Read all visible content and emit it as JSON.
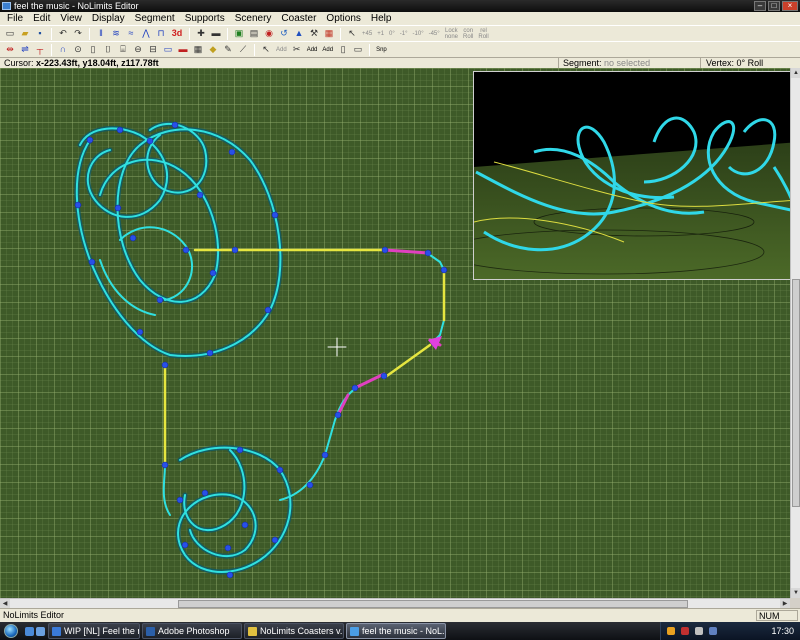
{
  "window": {
    "title": "feel the music - NoLimits Editor",
    "controls": [
      "minimize",
      "maximize",
      "close"
    ]
  },
  "menu": [
    "File",
    "Edit",
    "View",
    "Display",
    "Segment",
    "Supports",
    "Scenery",
    "Coaster",
    "Options",
    "Help"
  ],
  "toolbar1": {
    "labels": {
      "3d": "3d",
      "plus45": "+45",
      "plus1": "+1",
      "zero": "0°",
      "minus1": "-1°",
      "minus10": "-10°",
      "minus45": "-45°",
      "lock": "Lock\nnone",
      "con": "con\nRoll",
      "rel": "rel\nRoll"
    }
  },
  "toolbar2": {
    "labels": {
      "add1": "Add",
      "add2": "Add",
      "add3": "Add",
      "snp": "Snp"
    }
  },
  "status_row": {
    "cursor_label": "Cursor:",
    "cursor_value": "x-223.43ft, y18.04ft, z117.78ft",
    "segment_label": "Segment:",
    "segment_value": "no selected",
    "vertex_label": "Vertex:",
    "vertex_value": "0° Roll"
  },
  "app_status": {
    "text": "NoLimits Editor",
    "num_indicator": "NUM"
  },
  "taskbar": {
    "tasks": [
      {
        "label": "WIP [NL] Feel the m...",
        "icon_color": "#3a7ad8",
        "active": false
      },
      {
        "label": "Adobe Photoshop",
        "icon_color": "#2b5fa8",
        "active": false
      },
      {
        "label": "NoLimits Coasters v...",
        "icon_color": "#e0c040",
        "active": false
      },
      {
        "label": "feel the music - NoL...",
        "icon_color": "#4a9ee6",
        "active": true
      }
    ],
    "clock": "17:30"
  },
  "colors": {
    "track": "#2fd5d5",
    "track_highlight": "#e6e640",
    "segment_selected": "#e040c0",
    "node": "#2040e0",
    "grid_bg": "#3e5a28"
  }
}
